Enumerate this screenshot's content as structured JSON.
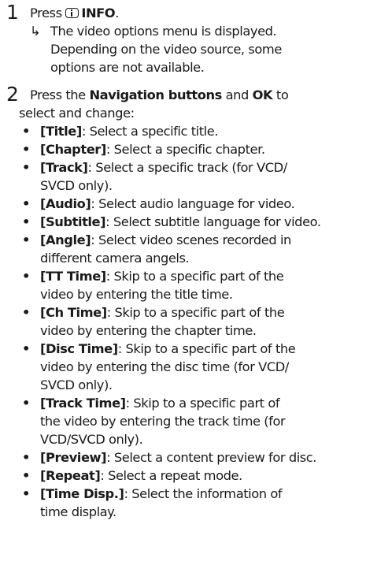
{
  "step1": {
    "number": "1",
    "press_text": "Press",
    "icon": "info-icon",
    "button_label": "INFO",
    "period": ".",
    "result_arrow": "↳",
    "result_lines": [
      "The video options menu is displayed.",
      "Depending on the video source, some",
      "options are not available."
    ]
  },
  "step2": {
    "number": "2",
    "intro_prefix": "Press the",
    "intro_bold_1": "Navigation buttons",
    "intro_and": "and",
    "intro_bold_2": "OK",
    "intro_suffix": "to",
    "intro_line2": "select and change:",
    "bullet_symbol": "•",
    "options": [
      {
        "label": "[Title]",
        "lines": [
          ": Select a specific title."
        ]
      },
      {
        "label": "[Chapter]",
        "lines": [
          ": Select a specific chapter."
        ]
      },
      {
        "label": "[Track]",
        "lines": [
          ": Select a specific track (for VCD/",
          "SVCD only)."
        ]
      },
      {
        "label": "[Audio]",
        "lines": [
          ": Select audio language for video."
        ]
      },
      {
        "label": "[Subtitle]",
        "lines": [
          ": Select subtitle language for video."
        ]
      },
      {
        "label": "[Angle]",
        "lines": [
          ": Select video scenes recorded in",
          "different camera angels."
        ]
      },
      {
        "label": "[TT Time]",
        "lines": [
          ": Skip to a specific part of the",
          "video by entering the title time."
        ]
      },
      {
        "label": "[Ch Time]",
        "lines": [
          ": Skip to a specific part of the",
          "video by entering the chapter time."
        ]
      },
      {
        "label": "[Disc Time]",
        "lines": [
          ": Skip to a specific part of the",
          "video by entering the disc time (for VCD/",
          "SVCD only)."
        ]
      },
      {
        "label": "[Track Time]",
        "lines": [
          ": Skip to a specific part of",
          "the video by entering the track time (for",
          "VCD/SVCD only)."
        ]
      },
      {
        "label": "[Preview]",
        "lines": [
          ": Select a content preview for disc."
        ]
      },
      {
        "label": "[Repeat]",
        "lines": [
          ": Select a repeat mode."
        ]
      },
      {
        "label": "[Time Disp.]",
        "lines": [
          ": Select the information of",
          "time display."
        ]
      }
    ]
  }
}
